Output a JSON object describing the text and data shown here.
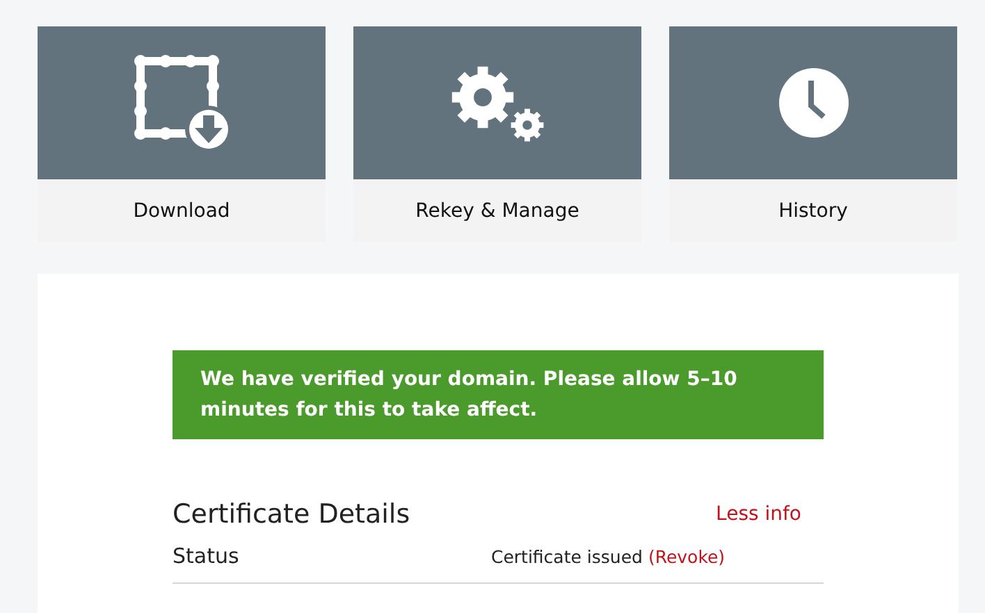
{
  "actions": [
    {
      "kind": "download",
      "label": "Download"
    },
    {
      "kind": "manage",
      "label": "Rekey & Manage"
    },
    {
      "kind": "history",
      "label": "History"
    }
  ],
  "alert": {
    "message": "We have verified your domain. Please allow 5–10 minutes for this to take affect."
  },
  "details": {
    "title": "Certificate Details",
    "toggle": "Less info",
    "rows": [
      {
        "label": "Status",
        "value": "Certificate issued",
        "link": "(Revoke)"
      }
    ]
  }
}
